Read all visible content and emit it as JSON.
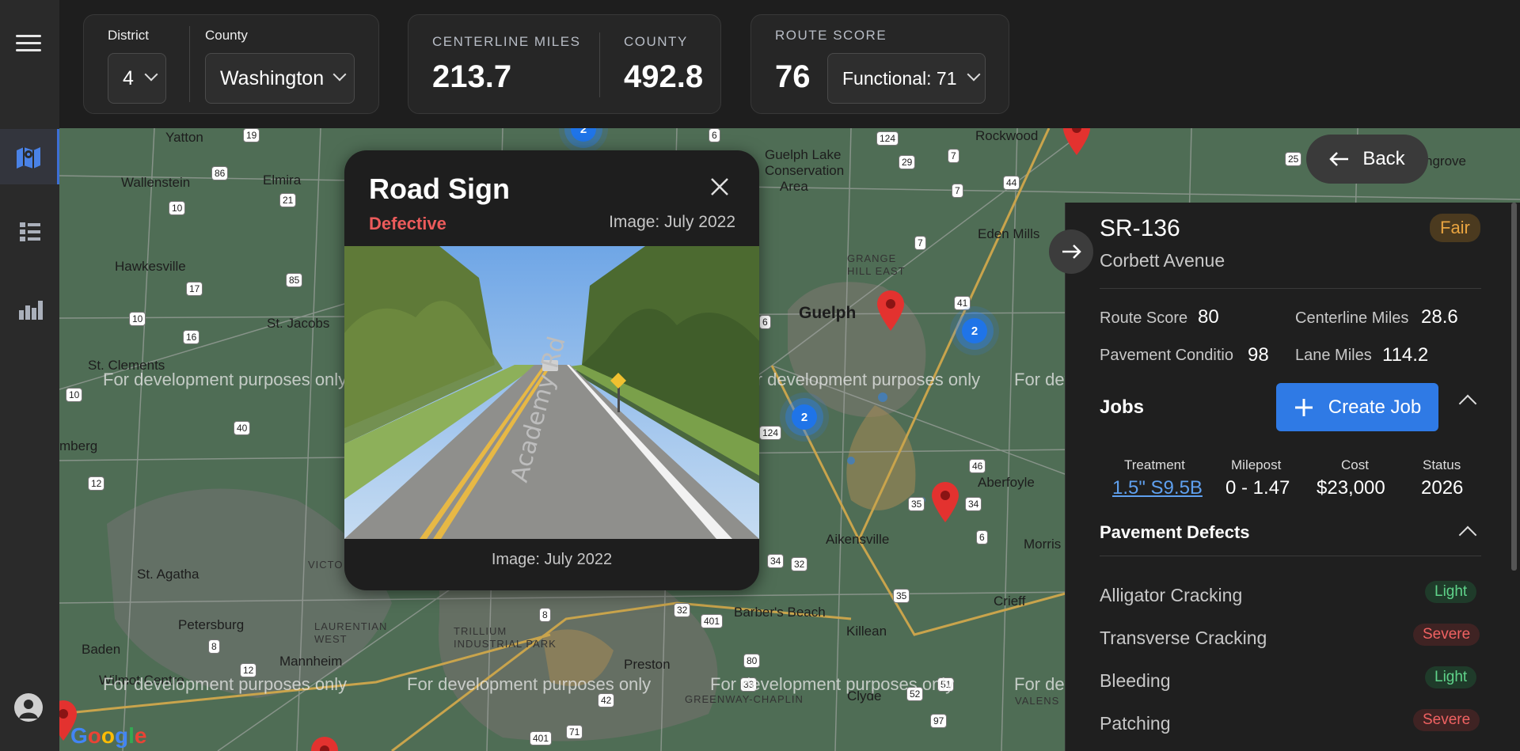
{
  "filters": {
    "district_label": "District",
    "district_value": "4",
    "county_label": "County",
    "county_value": "Washington"
  },
  "stats": {
    "centerline_label": "CENTERLINE MILES",
    "centerline_value": "213.7",
    "county_label": "COUNTY",
    "county_value": "492.8",
    "route_score_label": "ROUTE SCORE",
    "route_score_value": "76",
    "functional_value": "Functional: 71"
  },
  "map": {
    "watermark": "For development purposes only",
    "attribution": "Google",
    "towns": [
      "Yatton",
      "Wallenstein",
      "Elmira",
      "Hawkesville",
      "St. Jacobs",
      "St. Clements",
      "mberg",
      "St. Agatha",
      "Petersburg",
      "Baden",
      "Mannheim",
      "Wilmot Centre",
      "Guelph",
      "Guelph Lake Conservation Area",
      "GRANGE HILL EAST",
      "Rockwood",
      "Eden Mills",
      "Aberfoyle",
      "Aikensville",
      "Barber's Beach",
      "Killean",
      "Crieff",
      "Preston",
      "Clyde",
      "TRILLIUM INDUSTRIAL PARK",
      "LAURENTIAN WEST",
      "GREENWAY-CHAPLIN",
      "VICTO",
      "Morris",
      "hgrove",
      "VALENS"
    ],
    "clusters": [
      "2",
      "2",
      "2"
    ]
  },
  "back_label": "Back",
  "route": {
    "id": "SR-136",
    "name": "Corbett Avenue",
    "condition": "Fair",
    "condition_color": "#e0a040",
    "route_score_label": "Route Score",
    "route_score": "80",
    "centerline_label": "Centerline Miles",
    "centerline": "28.6",
    "pavement_label": "Pavement Conditio",
    "pavement": "98",
    "lane_label": "Lane Miles",
    "lane": "114.2"
  },
  "jobs": {
    "title": "Jobs",
    "create_label": "Create Job",
    "columns": [
      "Treatment",
      "Milepost",
      "Cost",
      "Status"
    ],
    "row": {
      "treatment": "1.5\" S9.5B",
      "milepost": "0 - 1.47",
      "cost": "$23,000",
      "status": "2026"
    }
  },
  "defects": {
    "title": "Pavement Defects",
    "items": [
      {
        "name": "Alligator Cracking",
        "severity": "Light"
      },
      {
        "name": "Transverse Cracking",
        "severity": "Severe"
      },
      {
        "name": "Bleeding",
        "severity": "Light"
      },
      {
        "name": "Patching",
        "severity": "Severe"
      }
    ]
  },
  "modal": {
    "title": "Road Sign",
    "status": "Defective",
    "image_date_top": "Image: July 2022",
    "image_date_bottom": "Image: July 2022",
    "road_text": "Academy Rd"
  }
}
